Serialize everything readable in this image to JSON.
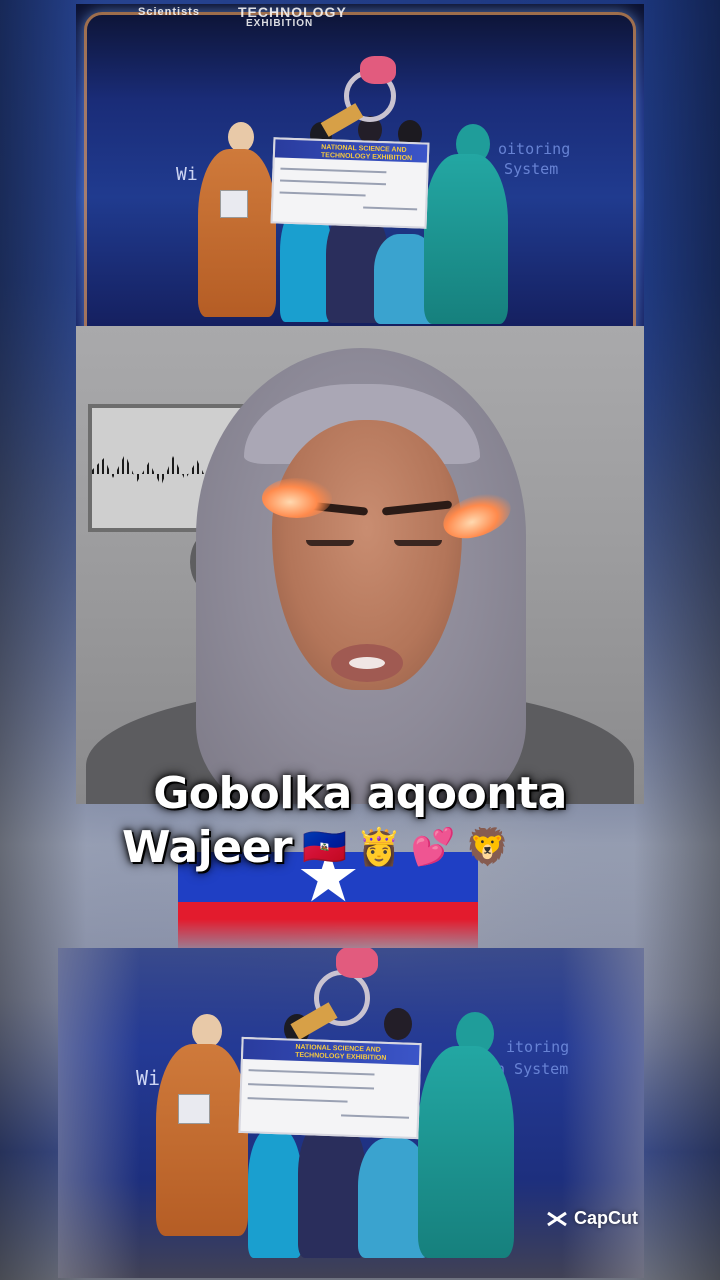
{
  "caption": {
    "line1": "Gobolka aqoonta",
    "line2": "Wajeer",
    "emojis": [
      "🇭🇹",
      "👸",
      "💕",
      "🦁"
    ]
  },
  "top_photo": {
    "banner_left": "Scientists",
    "banner_right": "TECHNOLOGY",
    "exhibition": "EXHIBITION",
    "screen_line1": "oitoring",
    "screen_line2": "n System",
    "side_text": "Wi",
    "cheque_title": "NATIONAL SCIENCE AND TECHNOLOGY EXHIBITION"
  },
  "bottom_photo": {
    "screen_line1": "itoring",
    "screen_line2": "n System",
    "side_text": "Wi",
    "cheque_title": "NATIONAL SCIENCE AND TECHNOLOGY EXHIBITION"
  },
  "watermark": {
    "label": "CapCut",
    "icon": "capcut-logo-icon"
  },
  "colors": {
    "flag_blue": "#1f3fc4",
    "flag_red": "#e31b2d",
    "stage_blue": "#203b8f",
    "hijab_grey": "#9c99a6",
    "teal_dress": "#1a9c9a",
    "orange_dress": "#c4692f"
  }
}
